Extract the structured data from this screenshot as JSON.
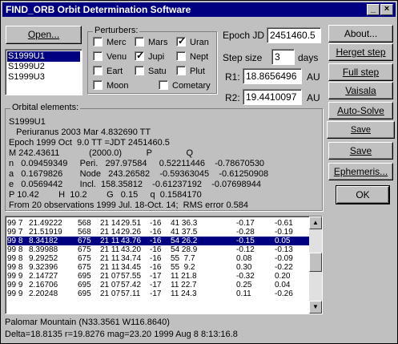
{
  "window": {
    "title": "FIND_ORB Orbit Determination Software",
    "buttons": {
      "minimize": "_",
      "close": "×"
    }
  },
  "open_button": "Open...",
  "object_list": [
    "S1999U1",
    "S1999U2",
    "S1999U3"
  ],
  "selected_object_index": 0,
  "perturbers": {
    "label": "Perturbers:",
    "items": [
      {
        "label": "Merc",
        "checked": false
      },
      {
        "label": "Mars",
        "checked": false
      },
      {
        "label": "Uran",
        "checked": true
      },
      {
        "label": "Venu",
        "checked": false
      },
      {
        "label": "Jupi",
        "checked": true
      },
      {
        "label": "Nept",
        "checked": false
      },
      {
        "label": "Eart",
        "checked": false
      },
      {
        "label": "Satu",
        "checked": false
      },
      {
        "label": "Plut",
        "checked": false
      },
      {
        "label": "Moon",
        "checked": false
      },
      {
        "label": "Cometary",
        "checked": false
      }
    ]
  },
  "epoch": {
    "label": "Epoch JD",
    "value": "2451460.5"
  },
  "step": {
    "label": "Step size",
    "value": "3",
    "unit": "days"
  },
  "r1": {
    "label": "R1:",
    "value": "18.8656496",
    "unit": "AU"
  },
  "r2": {
    "label": "R2:",
    "value": "19.4410097",
    "unit": "AU"
  },
  "right_buttons": {
    "about": "About...",
    "herget": "Herget step",
    "full": "Full step",
    "vaisala": "Vaisala",
    "auto": "Auto-Solve",
    "save_resid": "Save Residuals...",
    "save_elem": "Save elements",
    "ephem": "Ephemeris...",
    "ok": "OK"
  },
  "orbital_elements": {
    "label": "Orbital elements:",
    "lines": [
      "S1999U1",
      "   Periuranus 2003 Mar 4.832690 TT",
      "Epoch 1999 Oct  9.0 TT =JDT 2451460.5",
      "M 242.43611            (2000.0)          P              Q",
      "n   0.09459349     Peri.   297.97584     0.52211446    -0.78670530",
      "a   0.1679826       Node   243.26582    -0.59363045    -0.61250908",
      "e   0.0569442       Incl.  158.35812    -0.61237192    -0.07698944",
      "P 10.42        H  10.2        G   0.15     q  0.1584170",
      "From 20 observations 1999 Jul. 18-Oct. 14;  RMS error 0.584"
    ]
  },
  "observations": [
    [
      "99 7",
      "21.49222",
      "568",
      "21 14",
      "29.51",
      "-16",
      "41 36.3",
      "-0.17",
      "-0.61"
    ],
    [
      "99 7",
      "21.51919",
      "568",
      "21 14",
      "29.26",
      "-16",
      "41 37.5",
      "-0.28",
      "-0.19"
    ],
    [
      "99 8",
      "8.34182",
      "675",
      "21 11",
      "43.76",
      "-16",
      "54 26.2",
      "-0.15",
      "0.05"
    ],
    [
      "99 8",
      "8.39988",
      "675",
      "21 11",
      "43.20",
      "-16",
      "54 28.9",
      "-0.12",
      "-0.13"
    ],
    [
      "99 8",
      "9.29252",
      "675",
      "21 11",
      "34.74",
      "-16",
      "55  7.7",
      "0.08",
      "-0.09"
    ],
    [
      "99 8",
      "9.32396",
      "675",
      "21 11",
      "34.45",
      "-16",
      "55  9.2",
      "0.30",
      "-0.22"
    ],
    [
      "99 9",
      "2.14727",
      "695",
      "21 07",
      "57.55",
      "-17",
      "11 21.8",
      "-0.32",
      "0.20"
    ],
    [
      "99 9",
      "2.16706",
      "695",
      "21 07",
      "57.42",
      "-17",
      "11 22.7",
      "0.25",
      "0.04"
    ],
    [
      "99 9",
      "2.20248",
      "695",
      "21 07",
      "57.11",
      "-17",
      "11 24.3",
      "0.11",
      "-0.26"
    ]
  ],
  "selected_observation_index": 2,
  "status": {
    "line1": "Palomar Mountain  (N33.3561 W116.8640)",
    "line2": "Delta=18.8135 r=19.8276 mag=23.20  1999 Aug  8  8:13:16.8"
  }
}
